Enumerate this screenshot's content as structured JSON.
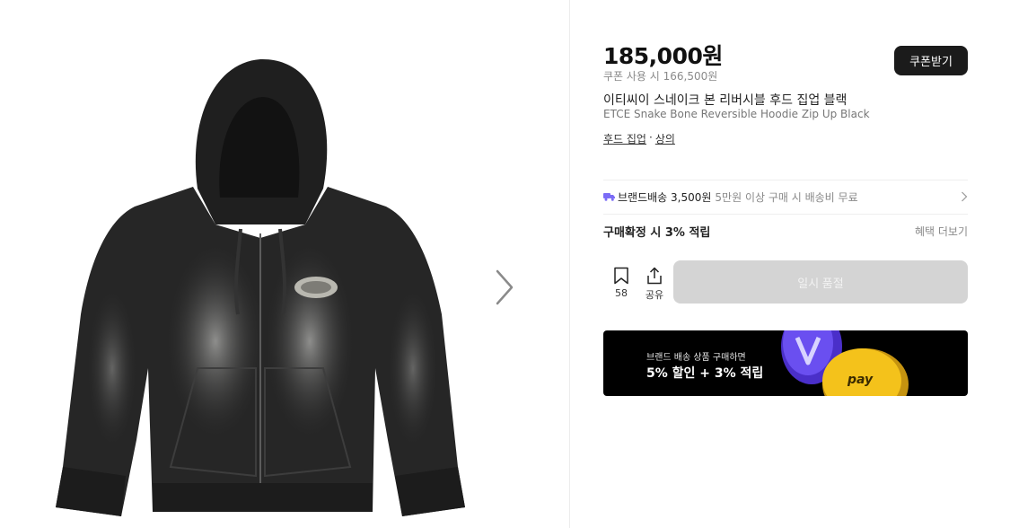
{
  "product": {
    "price": "185,000원",
    "coupon_price": "쿠폰 사용 시 166,500원",
    "name_ko": "이티씨이 스네이크 본 리버시블 후드 집업 블랙",
    "name_en": "ETCE Snake Bone Reversible Hoodie Zip Up Black",
    "category": {
      "sub": "후드 집업",
      "separator": "·",
      "main": "상의"
    }
  },
  "coupon_button": {
    "label": "쿠폰받기"
  },
  "shipping": {
    "fee": "브랜드배송 3,500원",
    "condition": "5만원 이상 구매 시 배송비 무료"
  },
  "benefits": {
    "points": "구매확정 시 3% 적립",
    "more": "혜택 더보기"
  },
  "actions": {
    "bookmark_count": "58",
    "share_label": "공유",
    "soldout_label": "일시 품절"
  },
  "banner": {
    "line1": "브랜드 배송 상품 구매하면",
    "line2": "5% 할인 + 3% 적립",
    "coin_text": "pay"
  },
  "colors": {
    "dark_button": "#1b1b1b",
    "disabled_button": "#d4d4d4",
    "truck_icon": "#7b6cf6",
    "banner_bg": "#000000",
    "coin_gold": "#f4c21b",
    "coin_purple": "#5b3fe0"
  },
  "icons": [
    "chevron-right-icon",
    "truck-icon",
    "bookmark-icon",
    "share-icon"
  ]
}
